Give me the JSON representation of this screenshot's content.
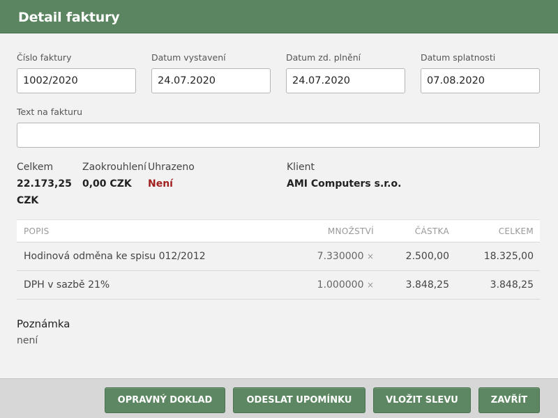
{
  "header": {
    "title": "Detail faktury"
  },
  "fields": {
    "invoice_number": {
      "label": "Číslo faktury",
      "value": "1002/2020"
    },
    "issue_date": {
      "label": "Datum vystavení",
      "value": "24.07.2020"
    },
    "taxable_date": {
      "label": "Datum zd. plnění",
      "value": "24.07.2020"
    },
    "due_date": {
      "label": "Datum splatnosti",
      "value": "07.08.2020"
    },
    "invoice_text": {
      "label": "Text na fakturu",
      "value": ""
    }
  },
  "summary": {
    "total": {
      "label": "Celkem",
      "value_line1": "22.173,25",
      "value_line2": "CZK"
    },
    "rounding": {
      "label": "Zaokrouhlení",
      "value": "0,00 CZK"
    },
    "paid": {
      "label": "Uhrazeno",
      "value": "Není",
      "color": "#a11f1f"
    },
    "client": {
      "label": "Klient",
      "value": "AMI Computers s.r.o."
    }
  },
  "table": {
    "headers": {
      "description": "POPIS",
      "quantity": "MNOŽSTVÍ",
      "amount": "ČÁSTKA",
      "total": "CELKEM"
    },
    "rows": [
      {
        "description": "Hodinová odměna ke spisu 012/2012",
        "quantity": "7.330000",
        "mult": "×",
        "amount": "2.500,00",
        "total": "18.325,00"
      },
      {
        "description": "DPH v sazbě 21%",
        "quantity": "1.000000",
        "mult": "×",
        "amount": "3.848,25",
        "total": "3.848,25"
      }
    ]
  },
  "note": {
    "title": "Poznámka",
    "text": "není"
  },
  "footer": {
    "corrective_label": "OPRAVNÝ DOKLAD",
    "reminder_label": "ODESLAT UPOMÍNKU",
    "discount_label": "VLOŽIT SLEVU",
    "close_label": "ZAVŘÍT"
  },
  "colors": {
    "header": "#5b8560",
    "button": "#5d8762",
    "paid_status": "#a11f1f"
  }
}
